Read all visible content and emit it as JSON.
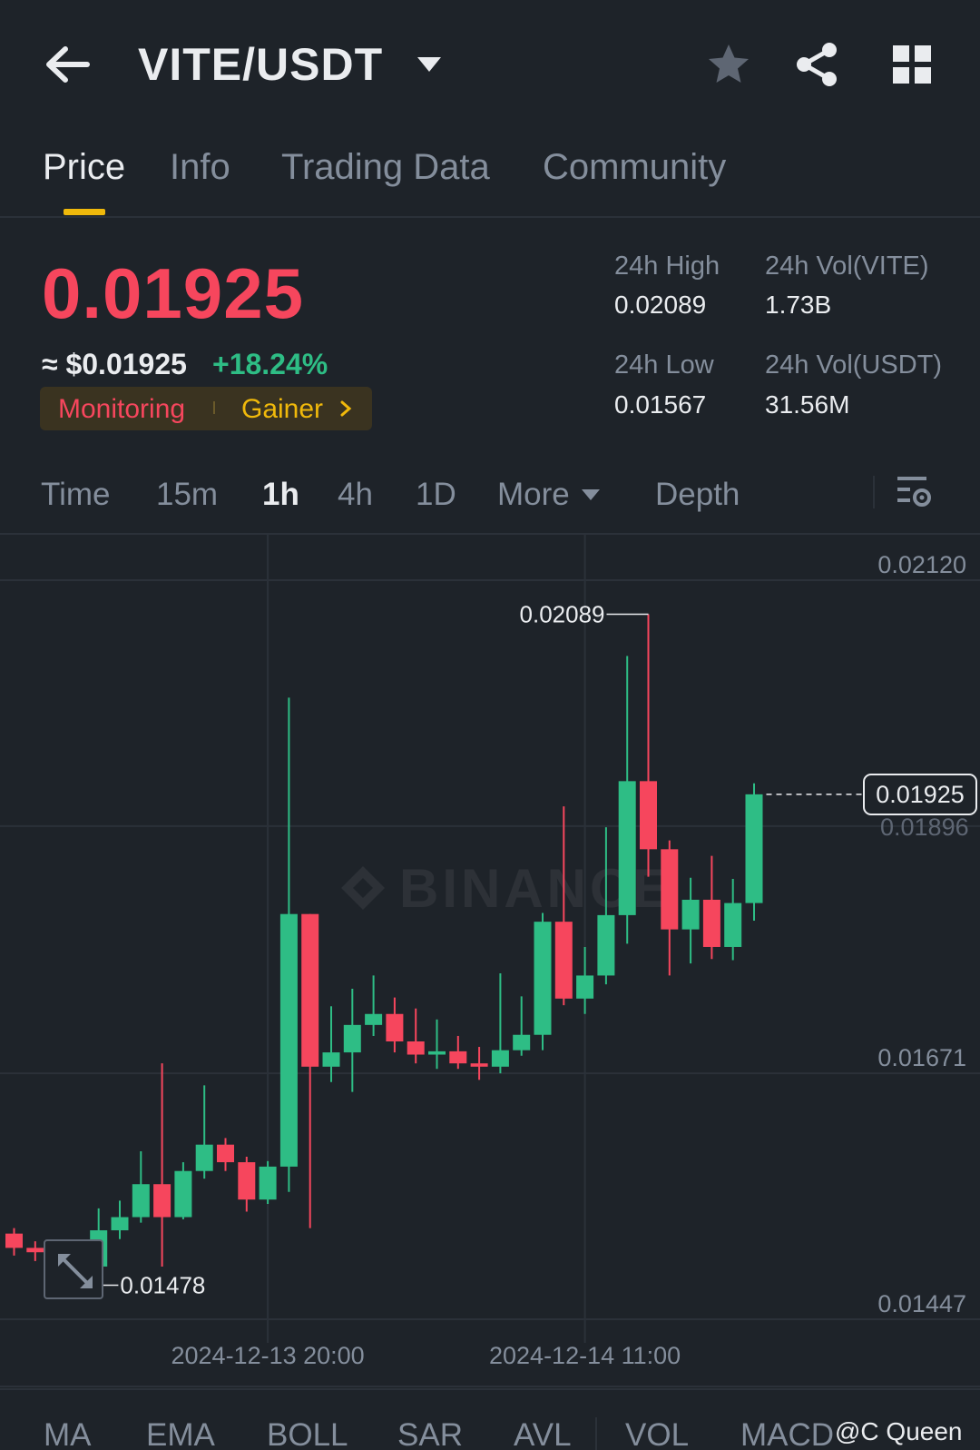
{
  "header": {
    "pair": "VITE/USDT",
    "icons": [
      "back-arrow-icon",
      "caret-down-icon",
      "star-icon",
      "share-icon",
      "grid-icon"
    ]
  },
  "tabs": [
    {
      "label": "Price",
      "active": true
    },
    {
      "label": "Info",
      "active": false
    },
    {
      "label": "Trading Data",
      "active": false
    },
    {
      "label": "Community",
      "active": false
    }
  ],
  "summary": {
    "last_price": "0.01925",
    "usd_price": "≈ $0.01925",
    "change": "+18.24%",
    "tags": [
      "Monitoring",
      "Gainer"
    ],
    "stats": {
      "high_label": "24h High",
      "high_value": "0.02089",
      "low_label": "24h Low",
      "low_value": "0.01567",
      "vol_base_label": "24h Vol(VITE)",
      "vol_base_value": "1.73B",
      "vol_quote_label": "24h Vol(USDT)",
      "vol_quote_value": "31.56M"
    }
  },
  "intervals": [
    "Time",
    "15m",
    "1h",
    "4h",
    "1D",
    "More",
    "Depth"
  ],
  "active_interval": "1h",
  "colors": {
    "up": "#2ebd85",
    "down": "#f6465d",
    "accent": "#f0b90b",
    "background": "#1e2329"
  },
  "chart_data": {
    "type": "candlestick",
    "watermark": "BINANCE",
    "y_ticks": [
      "0.02120",
      "0.01671",
      "0.01447"
    ],
    "ylim": [
      0.01447,
      0.0212
    ],
    "x_ticks": [
      {
        "label": "2024-12-13 20:00",
        "index": 12
      },
      {
        "label": "2024-12-14 11:00",
        "index": 27
      }
    ],
    "high_marker": "0.02089",
    "low_marker": "0.01478",
    "current_price": "0.01925",
    "candles": [
      {
        "o": 0.01525,
        "h": 0.0153,
        "l": 0.01505,
        "c": 0.01512
      },
      {
        "o": 0.01512,
        "h": 0.01518,
        "l": 0.015,
        "c": 0.01508
      },
      {
        "o": 0.01508,
        "h": 0.01512,
        "l": 0.01495,
        "c": 0.015
      },
      {
        "o": 0.015,
        "h": 0.01505,
        "l": 0.01478,
        "c": 0.01495
      },
      {
        "o": 0.01495,
        "h": 0.01548,
        "l": 0.0149,
        "c": 0.01528
      },
      {
        "o": 0.01528,
        "h": 0.01555,
        "l": 0.0152,
        "c": 0.0154
      },
      {
        "o": 0.0154,
        "h": 0.016,
        "l": 0.01535,
        "c": 0.0157
      },
      {
        "o": 0.0157,
        "h": 0.0168,
        "l": 0.01495,
        "c": 0.0154
      },
      {
        "o": 0.0154,
        "h": 0.0159,
        "l": 0.01538,
        "c": 0.01582
      },
      {
        "o": 0.01582,
        "h": 0.0166,
        "l": 0.01575,
        "c": 0.01606
      },
      {
        "o": 0.01606,
        "h": 0.01612,
        "l": 0.01582,
        "c": 0.0159
      },
      {
        "o": 0.0159,
        "h": 0.01595,
        "l": 0.01545,
        "c": 0.01556
      },
      {
        "o": 0.01556,
        "h": 0.01591,
        "l": 0.01552,
        "c": 0.01586
      },
      {
        "o": 0.01586,
        "h": 0.02013,
        "l": 0.01563,
        "c": 0.01816
      },
      {
        "o": 0.01816,
        "h": 0.01816,
        "l": 0.0153,
        "c": 0.01677
      },
      {
        "o": 0.01677,
        "h": 0.01732,
        "l": 0.01663,
        "c": 0.0169
      },
      {
        "o": 0.0169,
        "h": 0.01748,
        "l": 0.01654,
        "c": 0.01715
      },
      {
        "o": 0.01715,
        "h": 0.0176,
        "l": 0.01705,
        "c": 0.01725
      },
      {
        "o": 0.01725,
        "h": 0.0174,
        "l": 0.0169,
        "c": 0.017
      },
      {
        "o": 0.017,
        "h": 0.0173,
        "l": 0.0168,
        "c": 0.01688
      },
      {
        "o": 0.01688,
        "h": 0.0172,
        "l": 0.01675,
        "c": 0.01691
      },
      {
        "o": 0.01691,
        "h": 0.01705,
        "l": 0.01675,
        "c": 0.0168
      },
      {
        "o": 0.0168,
        "h": 0.01695,
        "l": 0.01665,
        "c": 0.01677
      },
      {
        "o": 0.01677,
        "h": 0.01762,
        "l": 0.01671,
        "c": 0.01692
      },
      {
        "o": 0.01692,
        "h": 0.01741,
        "l": 0.01687,
        "c": 0.01706
      },
      {
        "o": 0.01706,
        "h": 0.01817,
        "l": 0.01692,
        "c": 0.01809
      },
      {
        "o": 0.01809,
        "h": 0.01914,
        "l": 0.01733,
        "c": 0.01739
      },
      {
        "o": 0.01739,
        "h": 0.01786,
        "l": 0.01725,
        "c": 0.0176
      },
      {
        "o": 0.0176,
        "h": 0.01895,
        "l": 0.01752,
        "c": 0.01815
      },
      {
        "o": 0.01815,
        "h": 0.02051,
        "l": 0.01789,
        "c": 0.01937
      },
      {
        "o": 0.01937,
        "h": 0.02089,
        "l": 0.0185,
        "c": 0.01875
      },
      {
        "o": 0.01875,
        "h": 0.01883,
        "l": 0.0176,
        "c": 0.01802
      },
      {
        "o": 0.01802,
        "h": 0.01849,
        "l": 0.01771,
        "c": 0.01829
      },
      {
        "o": 0.01829,
        "h": 0.01869,
        "l": 0.01775,
        "c": 0.01786
      },
      {
        "o": 0.01786,
        "h": 0.01848,
        "l": 0.01774,
        "c": 0.01826
      },
      {
        "o": 0.01826,
        "h": 0.01935,
        "l": 0.0181,
        "c": 0.01925
      }
    ]
  },
  "indicators": [
    "MA",
    "EMA",
    "BOLL",
    "SAR",
    "AVL",
    "VOL",
    "MACD"
  ],
  "watermark_user": "@C Queen"
}
